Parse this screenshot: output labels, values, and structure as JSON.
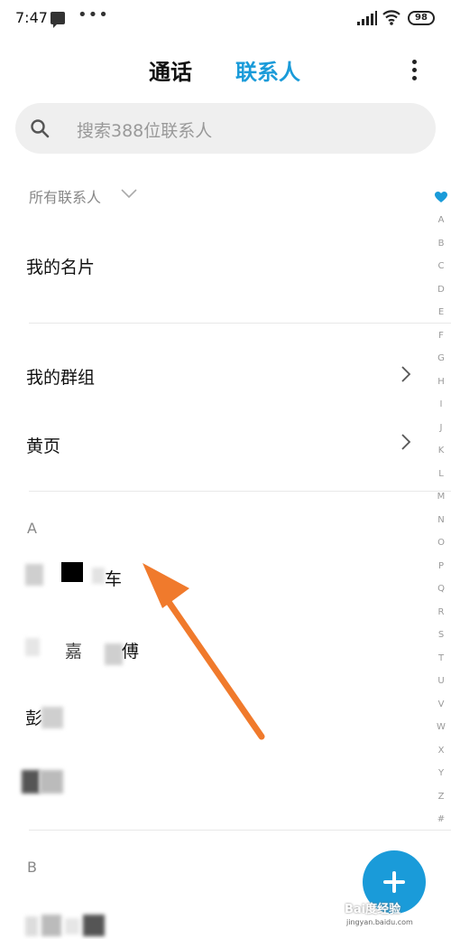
{
  "status_bar": {
    "time": "7:47",
    "dots": "•••",
    "battery": "98"
  },
  "header": {
    "tab_calls": "通话",
    "tab_contacts": "联系人"
  },
  "search": {
    "placeholder": "搜索388位联系人"
  },
  "filter": {
    "label": "所有联系人"
  },
  "rows": {
    "my_card": "我的名片",
    "my_groups": "我的群组",
    "yellow_pages": "黄页"
  },
  "sections": [
    {
      "letter": "A",
      "contacts": [
        "车",
        "傅",
        "彭",
        ""
      ]
    },
    {
      "letter": "B",
      "contacts": [
        ""
      ]
    }
  ],
  "contact_fragments": {
    "a1_end": "车",
    "a2_mid": "嘉",
    "a2_end": "傅",
    "a3_start": "彭"
  },
  "alphabet_index": [
    "A",
    "B",
    "C",
    "D",
    "E",
    "F",
    "G",
    "H",
    "I",
    "J",
    "K",
    "L",
    "M",
    "N",
    "O",
    "P",
    "Q",
    "R",
    "S",
    "T",
    "U",
    "V",
    "W",
    "X",
    "Y",
    "Z",
    "#"
  ],
  "watermark": {
    "brand": "Bai度经验",
    "url": "jingyan.baidu.com"
  },
  "colors": {
    "accent": "#1a9bd9",
    "arrow": "#f07a2c",
    "search_bg": "#efefef"
  }
}
